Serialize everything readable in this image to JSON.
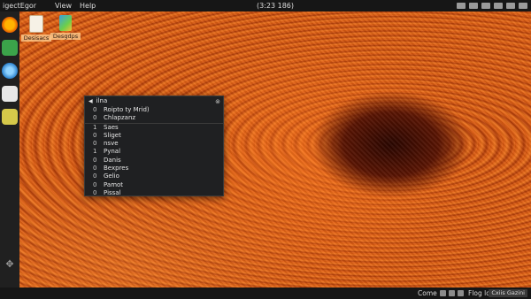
{
  "top_panel": {
    "menu": [
      "igectEgor",
      "View",
      "Help"
    ],
    "clock": "(3:23 186)"
  },
  "desktop_icons": [
    {
      "label": "Desisacs",
      "icon": "file-icon"
    },
    {
      "label": "Desgdps",
      "icon": "image-file-icon"
    }
  ],
  "dock": {
    "items": [
      "firefox-icon",
      "files-icon",
      "browser-icon",
      "text-editor-icon",
      "package-icon"
    ],
    "bottom": "apps-grid-icon"
  },
  "context_menu": {
    "title": "ilna",
    "items": [
      {
        "num": "0",
        "label": "Roipto ty Mrid)",
        "sep": false
      },
      {
        "num": "0",
        "label": "Chlapzanz",
        "sep": false
      },
      {
        "num": "1",
        "label": "Saes",
        "sep": true
      },
      {
        "num": "0",
        "label": "Sliget",
        "sep": false
      },
      {
        "num": "0",
        "label": "nsve",
        "sep": false
      },
      {
        "num": "1",
        "label": "Pynal",
        "sep": false
      },
      {
        "num": "0",
        "label": "Danis",
        "sep": false
      },
      {
        "num": "0",
        "label": "Bexpres",
        "sep": false
      },
      {
        "num": "0",
        "label": "Gelio",
        "sep": false
      },
      {
        "num": "0",
        "label": "Pamot",
        "sep": false
      },
      {
        "num": "0",
        "label": "Pissal",
        "sep": false
      }
    ]
  },
  "bottom_panel": {
    "left": "Come",
    "right": "Flog long",
    "tag": "Cxiis Gazini"
  },
  "colors": {
    "panel": "#161616",
    "menu_bg": "#1f2022",
    "wallpaper": "#d3520d"
  }
}
